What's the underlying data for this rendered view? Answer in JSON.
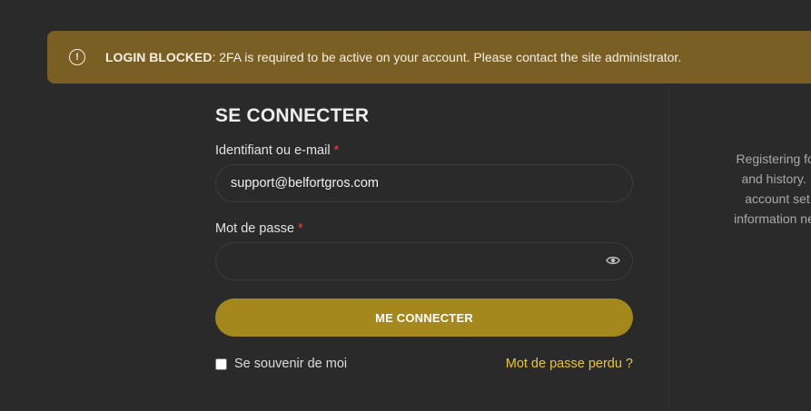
{
  "alert": {
    "icon": "info-circle-icon",
    "strong": "LOGIN BLOCKED",
    "message": ": 2FA is required to be active on your account. Please contact the site administrator."
  },
  "login": {
    "title": "SE CONNECTER",
    "username_label": "Identifiant ou e-mail",
    "required_mark": "*",
    "username_value": "support@belfortgros.com",
    "password_label": "Mot de passe",
    "password_value": "",
    "submit_label": "ME CONNECTER",
    "remember_label": "Se souvenir de moi",
    "lost_password": "Mot de passe perdu ?"
  },
  "register": {
    "lines": [
      "Registering for",
      "and history. ,",
      "account set",
      "information nec"
    ]
  },
  "colors": {
    "background": "#2a2a2b",
    "alert": "#7a5f25",
    "button": "#a4881d",
    "link": "#e8c531",
    "required": "#e04848"
  }
}
